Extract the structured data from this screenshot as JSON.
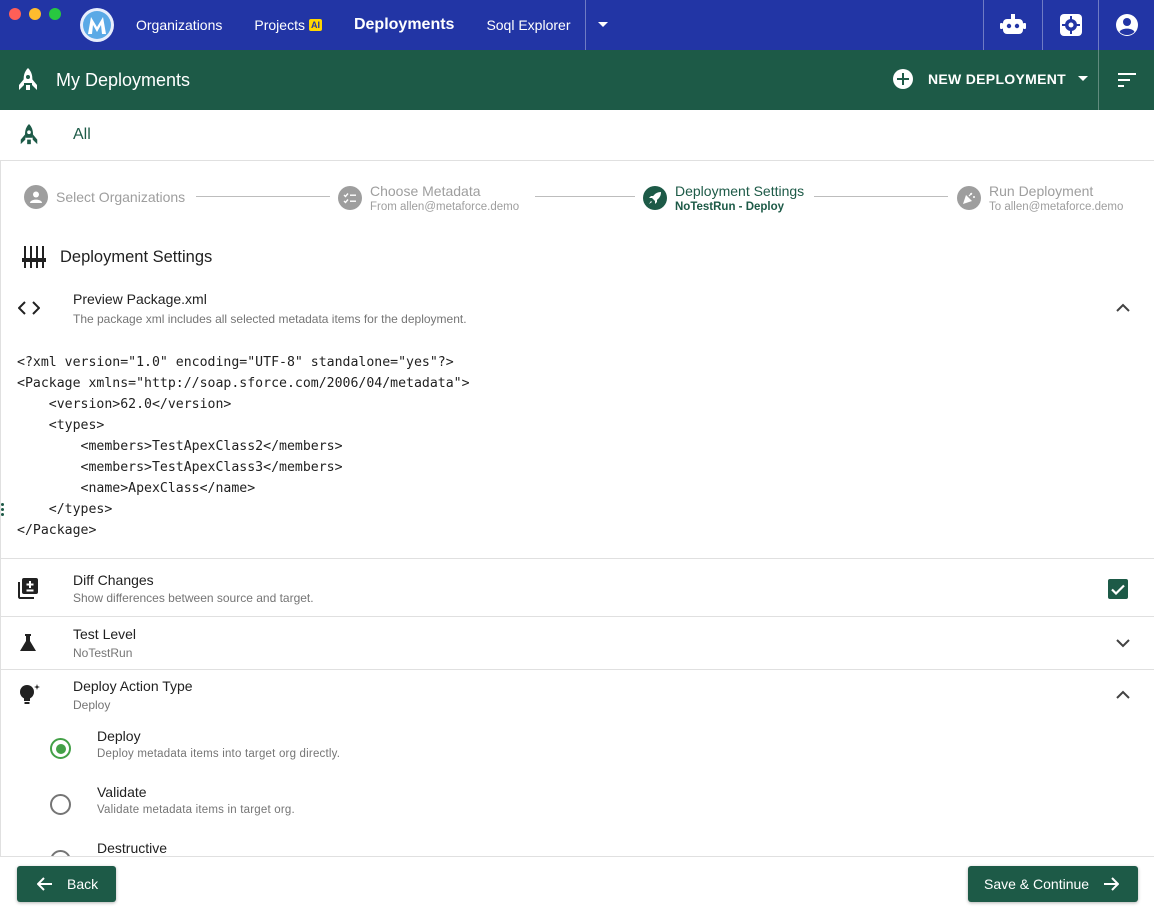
{
  "colors": {
    "topbar": "#2235a5",
    "header": "#1d5a47",
    "accent": "#1d5a47",
    "radio_selected": "#43a047"
  },
  "topnav": {
    "items": [
      {
        "label": "Organizations"
      },
      {
        "label": "Projects",
        "badge": "AI"
      },
      {
        "label": "Deployments",
        "active": true
      },
      {
        "label": "Soql Explorer"
      }
    ],
    "icons": [
      "robot-icon",
      "settings-icon",
      "account-icon"
    ]
  },
  "header": {
    "title": "My Deployments",
    "new_deployment_label": "NEW DEPLOYMENT"
  },
  "filter": {
    "label": "All"
  },
  "stepper": [
    {
      "title": "Select Organizations",
      "subtitle": ""
    },
    {
      "title": "Choose Metadata",
      "subtitle": "From allen@metaforce.demo"
    },
    {
      "title": "Deployment Settings",
      "subtitle": "NoTestRun - Deploy",
      "active": true
    },
    {
      "title": "Run Deployment",
      "subtitle": "To allen@metaforce.demo"
    }
  ],
  "section": {
    "title": "Deployment Settings"
  },
  "preview": {
    "title": "Preview Package.xml",
    "subtitle": "The package xml includes all selected metadata items for the deployment.",
    "xml": "<?xml version=\"1.0\" encoding=\"UTF-8\" standalone=\"yes\"?>\n<Package xmlns=\"http://soap.sforce.com/2006/04/metadata\">\n    <version>62.0</version>\n    <types>\n        <members>TestApexClass2</members>\n        <members>TestApexClass3</members>\n        <name>ApexClass</name>\n    </types>\n</Package>"
  },
  "diff": {
    "title": "Diff Changes",
    "subtitle": "Show differences between source and target.",
    "checked": true
  },
  "test_level": {
    "title": "Test Level",
    "value": "NoTestRun"
  },
  "deploy_action": {
    "title": "Deploy Action Type",
    "value": "Deploy",
    "options": [
      {
        "label": "Deploy",
        "description": "Deploy metadata items into target org directly.",
        "selected": true
      },
      {
        "label": "Validate",
        "description": "Validate metadata items in target org.",
        "selected": false
      },
      {
        "label": "Destructive",
        "description": "",
        "selected": false
      }
    ]
  },
  "footer": {
    "back_label": "Back",
    "save_label": "Save & Continue"
  }
}
